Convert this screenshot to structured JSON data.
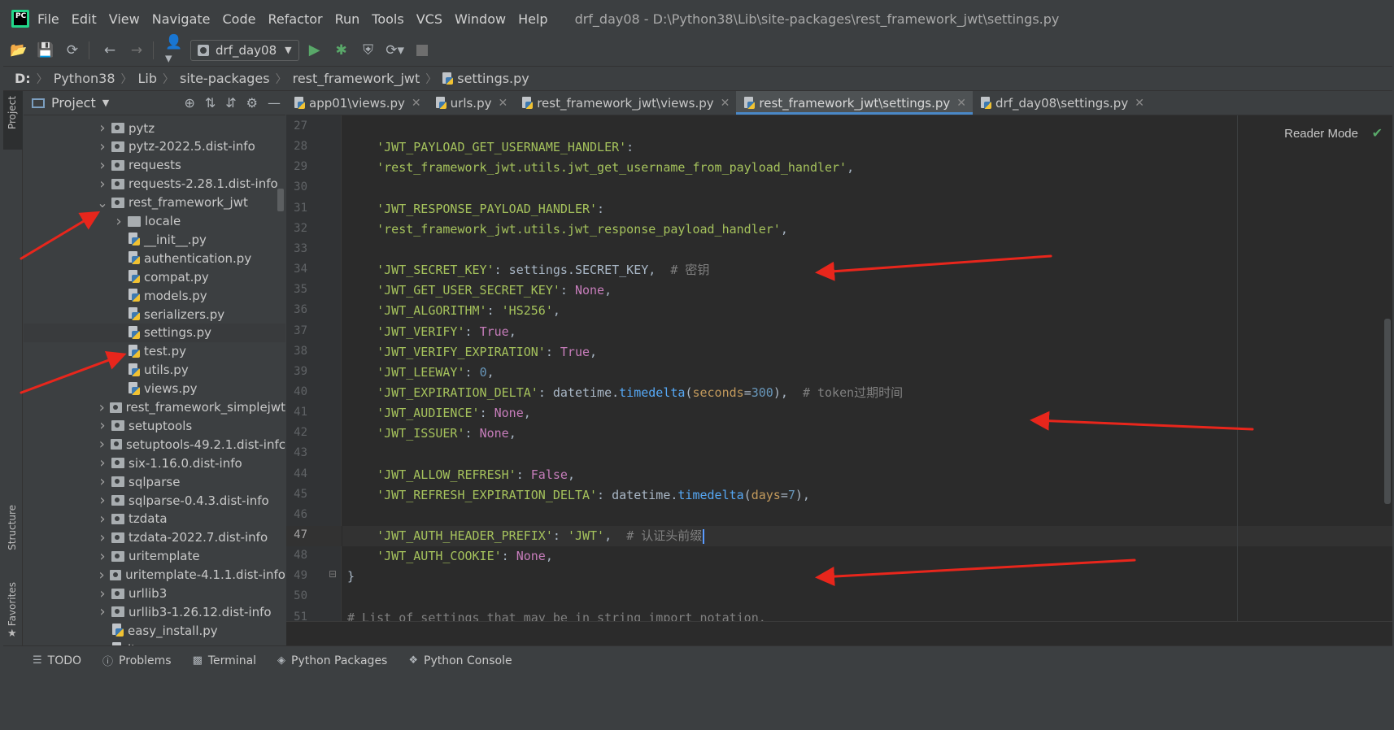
{
  "app": {
    "logo_text": "PC",
    "menu": [
      "File",
      "Edit",
      "View",
      "Navigate",
      "Code",
      "Refactor",
      "Run",
      "Tools",
      "VCS",
      "Window",
      "Help"
    ],
    "window_title": "drf_day08 - D:\\Python38\\Lib\\site-packages\\rest_framework_jwt\\settings.py"
  },
  "toolbar": {
    "run_config": "drf_day08"
  },
  "breadcrumb": [
    "D:",
    "Python38",
    "Lib",
    "site-packages",
    "rest_framework_jwt",
    "settings.py"
  ],
  "left_strip": {
    "project_label": "Project",
    "structure_label": "Structure",
    "favorites_label": "Favorites"
  },
  "project_panel": {
    "title": "Project",
    "tree": [
      {
        "label": "pytz",
        "type": "folder",
        "depth": 0,
        "expanded": false
      },
      {
        "label": "pytz-2022.5.dist-info",
        "type": "folder",
        "depth": 0,
        "expanded": false
      },
      {
        "label": "requests",
        "type": "folder",
        "depth": 0,
        "expanded": false
      },
      {
        "label": "requests-2.28.1.dist-info",
        "type": "folder",
        "depth": 0,
        "expanded": false
      },
      {
        "label": "rest_framework_jwt",
        "type": "folder",
        "depth": 0,
        "expanded": true
      },
      {
        "label": "locale",
        "type": "folder",
        "depth": 1,
        "expanded": false
      },
      {
        "label": "__init__.py",
        "type": "file",
        "depth": 1
      },
      {
        "label": "authentication.py",
        "type": "file",
        "depth": 1
      },
      {
        "label": "compat.py",
        "type": "file",
        "depth": 1
      },
      {
        "label": "models.py",
        "type": "file",
        "depth": 1
      },
      {
        "label": "serializers.py",
        "type": "file",
        "depth": 1
      },
      {
        "label": "settings.py",
        "type": "file",
        "depth": 1,
        "selected": true
      },
      {
        "label": "test.py",
        "type": "file",
        "depth": 1
      },
      {
        "label": "utils.py",
        "type": "file",
        "depth": 1
      },
      {
        "label": "views.py",
        "type": "file",
        "depth": 1
      },
      {
        "label": "rest_framework_simplejwt",
        "type": "folder",
        "depth": 0,
        "expanded": false
      },
      {
        "label": "setuptools",
        "type": "folder",
        "depth": 0,
        "expanded": false
      },
      {
        "label": "setuptools-49.2.1.dist-infc",
        "type": "folder",
        "depth": 0,
        "expanded": false
      },
      {
        "label": "six-1.16.0.dist-info",
        "type": "folder",
        "depth": 0,
        "expanded": false
      },
      {
        "label": "sqlparse",
        "type": "folder",
        "depth": 0,
        "expanded": false
      },
      {
        "label": "sqlparse-0.4.3.dist-info",
        "type": "folder",
        "depth": 0,
        "expanded": false
      },
      {
        "label": "tzdata",
        "type": "folder",
        "depth": 0,
        "expanded": false
      },
      {
        "label": "tzdata-2022.7.dist-info",
        "type": "folder",
        "depth": 0,
        "expanded": false
      },
      {
        "label": "uritemplate",
        "type": "folder",
        "depth": 0,
        "expanded": false
      },
      {
        "label": "uritemplate-4.1.1.dist-info",
        "type": "folder",
        "depth": 0,
        "expanded": false
      },
      {
        "label": "urllib3",
        "type": "folder",
        "depth": 0,
        "expanded": false
      },
      {
        "label": "urllib3-1.26.12.dist-info",
        "type": "folder",
        "depth": 0,
        "expanded": false
      },
      {
        "label": "easy_install.py",
        "type": "file",
        "depth": 0
      },
      {
        "label": "itypes.py",
        "type": "file",
        "depth": 0
      }
    ]
  },
  "tabs": [
    {
      "label": "app01\\views.py",
      "active": false
    },
    {
      "label": "urls.py",
      "active": false
    },
    {
      "label": "rest_framework_jwt\\views.py",
      "active": false
    },
    {
      "label": "rest_framework_jwt\\settings.py",
      "active": true
    },
    {
      "label": "drf_day08\\settings.py",
      "active": false
    }
  ],
  "editor": {
    "reader_mode": "Reader Mode",
    "current_line": 47,
    "lines": [
      {
        "n": 27,
        "parts": []
      },
      {
        "n": 28,
        "parts": [
          [
            "s",
            "    'JWT_PAYLOAD_GET_USERNAME_HANDLER'"
          ],
          [
            "p",
            ":"
          ]
        ]
      },
      {
        "n": 29,
        "parts": [
          [
            "s",
            "    'rest_framework_jwt.utils.jwt_get_username_from_payload_handler'"
          ],
          [
            "p",
            ","
          ]
        ]
      },
      {
        "n": 30,
        "parts": []
      },
      {
        "n": 31,
        "parts": [
          [
            "s",
            "    'JWT_RESPONSE_PAYLOAD_HANDLER'"
          ],
          [
            "p",
            ":"
          ]
        ]
      },
      {
        "n": 32,
        "parts": [
          [
            "s",
            "    'rest_framework_jwt.utils.jwt_response_payload_handler'"
          ],
          [
            "p",
            ","
          ]
        ]
      },
      {
        "n": 33,
        "parts": []
      },
      {
        "n": 34,
        "parts": [
          [
            "s",
            "    'JWT_SECRET_KEY'"
          ],
          [
            "p",
            ": settings.SECRET_KEY,  "
          ],
          [
            "c",
            "# 密钥"
          ]
        ]
      },
      {
        "n": 35,
        "parts": [
          [
            "s",
            "    'JWT_GET_USER_SECRET_KEY'"
          ],
          [
            "p",
            ": "
          ],
          [
            "k",
            "None"
          ],
          [
            "p",
            ","
          ]
        ]
      },
      {
        "n": 36,
        "parts": [
          [
            "s",
            "    'JWT_ALGORITHM'"
          ],
          [
            "p",
            ": "
          ],
          [
            "s",
            "'HS256'"
          ],
          [
            "p",
            ","
          ]
        ]
      },
      {
        "n": 37,
        "parts": [
          [
            "s",
            "    'JWT_VERIFY'"
          ],
          [
            "p",
            ": "
          ],
          [
            "k",
            "True"
          ],
          [
            "p",
            ","
          ]
        ]
      },
      {
        "n": 38,
        "parts": [
          [
            "s",
            "    'JWT_VERIFY_EXPIRATION'"
          ],
          [
            "p",
            ": "
          ],
          [
            "k",
            "True"
          ],
          [
            "p",
            ","
          ]
        ]
      },
      {
        "n": 39,
        "parts": [
          [
            "s",
            "    'JWT_LEEWAY'"
          ],
          [
            "p",
            ": "
          ],
          [
            "n",
            "0"
          ],
          [
            "p",
            ","
          ]
        ]
      },
      {
        "n": 40,
        "parts": [
          [
            "s",
            "    'JWT_EXPIRATION_DELTA'"
          ],
          [
            "p",
            ": datetime."
          ],
          [
            "f",
            "timedelta"
          ],
          [
            "p",
            "("
          ],
          [
            "a",
            "seconds"
          ],
          [
            "p",
            "="
          ],
          [
            "n",
            "300"
          ],
          [
            "p",
            "),  "
          ],
          [
            "c",
            "# token过期时间"
          ]
        ]
      },
      {
        "n": 41,
        "parts": [
          [
            "s",
            "    'JWT_AUDIENCE'"
          ],
          [
            "p",
            ": "
          ],
          [
            "k",
            "None"
          ],
          [
            "p",
            ","
          ]
        ]
      },
      {
        "n": 42,
        "parts": [
          [
            "s",
            "    'JWT_ISSUER'"
          ],
          [
            "p",
            ": "
          ],
          [
            "k",
            "None"
          ],
          [
            "p",
            ","
          ]
        ]
      },
      {
        "n": 43,
        "parts": []
      },
      {
        "n": 44,
        "parts": [
          [
            "s",
            "    'JWT_ALLOW_REFRESH'"
          ],
          [
            "p",
            ": "
          ],
          [
            "k",
            "False"
          ],
          [
            "p",
            ","
          ]
        ]
      },
      {
        "n": 45,
        "parts": [
          [
            "s",
            "    'JWT_REFRESH_EXPIRATION_DELTA'"
          ],
          [
            "p",
            ": datetime."
          ],
          [
            "f",
            "timedelta"
          ],
          [
            "p",
            "("
          ],
          [
            "a",
            "days"
          ],
          [
            "p",
            "="
          ],
          [
            "n",
            "7"
          ],
          [
            "p",
            "),"
          ]
        ]
      },
      {
        "n": 46,
        "parts": []
      },
      {
        "n": 47,
        "parts": [
          [
            "s",
            "    'JWT_AUTH_HEADER_PREFIX'"
          ],
          [
            "p",
            ": "
          ],
          [
            "s",
            "'JWT'"
          ],
          [
            "p",
            ",  "
          ],
          [
            "c",
            "# 认证头前缀"
          ]
        ]
      },
      {
        "n": 48,
        "parts": [
          [
            "s",
            "    'JWT_AUTH_COOKIE'"
          ],
          [
            "p",
            ": "
          ],
          [
            "k",
            "None"
          ],
          [
            "p",
            ","
          ]
        ]
      },
      {
        "n": 49,
        "parts": [
          [
            "p",
            "}"
          ]
        ]
      },
      {
        "n": 50,
        "parts": []
      },
      {
        "n": 51,
        "parts": [
          [
            "c",
            "# List of settings that may be in string import notation."
          ]
        ]
      }
    ]
  },
  "bottom_bar": [
    {
      "label": "TODO",
      "icon": "list-icon"
    },
    {
      "label": "Problems",
      "icon": "problems-icon"
    },
    {
      "label": "Terminal",
      "icon": "terminal-icon"
    },
    {
      "label": "Python Packages",
      "icon": "packages-icon"
    },
    {
      "label": "Python Console",
      "icon": "python-console-icon"
    }
  ],
  "colors": {
    "annotation_arrow": "#e8261c",
    "active_tab_underline": "#4a88c7"
  }
}
